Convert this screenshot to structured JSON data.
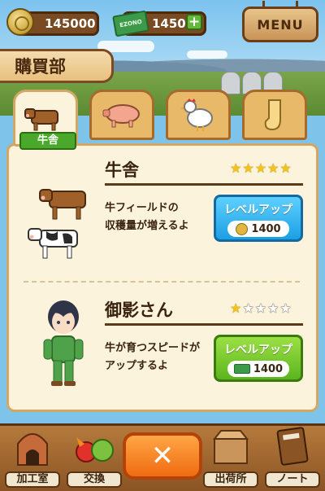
{
  "hud": {
    "coins": "145000",
    "ezono_label": "EZONO",
    "ezono": "1450",
    "add": "+",
    "menu": "MENU"
  },
  "shop": {
    "title": "購買部",
    "tabs": [
      {
        "name": "cow",
        "icon": "cow-icon"
      },
      {
        "name": "pig",
        "icon": "pig-icon"
      },
      {
        "name": "chicken",
        "icon": "chicken-icon"
      },
      {
        "name": "other",
        "icon": "glove-icon"
      }
    ],
    "active_tab_label": "牛舎"
  },
  "items": [
    {
      "name": "牛舎",
      "stars_filled": 5,
      "stars_total": 5,
      "desc_line1": "牛フィールドの",
      "desc_line2": "収穫量が増えるよ",
      "button_label": "レベルアップ",
      "price": "1400",
      "currency": "coin",
      "button_color": "#1c9fe4"
    },
    {
      "name": "御影さん",
      "stars_filled": 1,
      "stars_total": 5,
      "desc_line1": "牛が育つスピードが",
      "desc_line2": "アップするよ",
      "button_label": "レベルアップ",
      "price": "1400",
      "currency": "ezono",
      "button_color": "#5cb51e"
    }
  ],
  "nav": {
    "items": [
      "加工室",
      "交換",
      "出荷所",
      "ノート"
    ],
    "close": "✕"
  }
}
